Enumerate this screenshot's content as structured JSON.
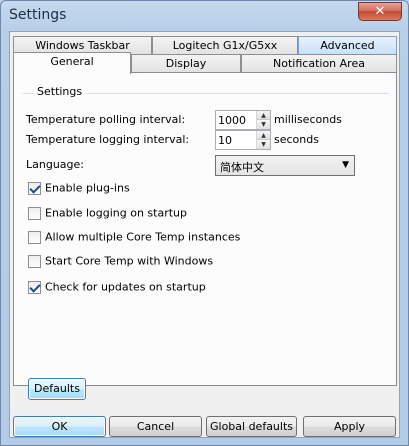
{
  "window": {
    "title": "Settings",
    "close_glyph": "✕"
  },
  "tabs": {
    "row1": [
      "Windows Taskbar",
      "Logitech G1x/G5xx",
      "Advanced"
    ],
    "row2": [
      "General",
      "Display",
      "Notification Area"
    ],
    "active": "General"
  },
  "general": {
    "group_label": "Settings",
    "polling_label": "Temperature polling interval:",
    "polling_value": "1000",
    "polling_unit": "milliseconds",
    "logging_label": "Temperature logging interval:",
    "logging_value": "10",
    "logging_unit": "seconds",
    "language_label": "Language:",
    "language_value": "简体中文",
    "checkboxes": [
      {
        "label": "Enable plug-ins",
        "checked": true
      },
      {
        "label": "Enable logging on startup",
        "checked": false
      },
      {
        "label": "Allow multiple Core Temp instances",
        "checked": false
      },
      {
        "label": "Start Core Temp with Windows",
        "checked": false
      },
      {
        "label": "Check for updates on startup",
        "checked": true
      }
    ],
    "defaults_button": "Defaults"
  },
  "footer": {
    "ok": "OK",
    "cancel": "Cancel",
    "global_defaults": "Global defaults",
    "apply": "Apply"
  },
  "icons": {
    "spin_up": "▲",
    "spin_down": "▼",
    "dropdown": "▼"
  }
}
